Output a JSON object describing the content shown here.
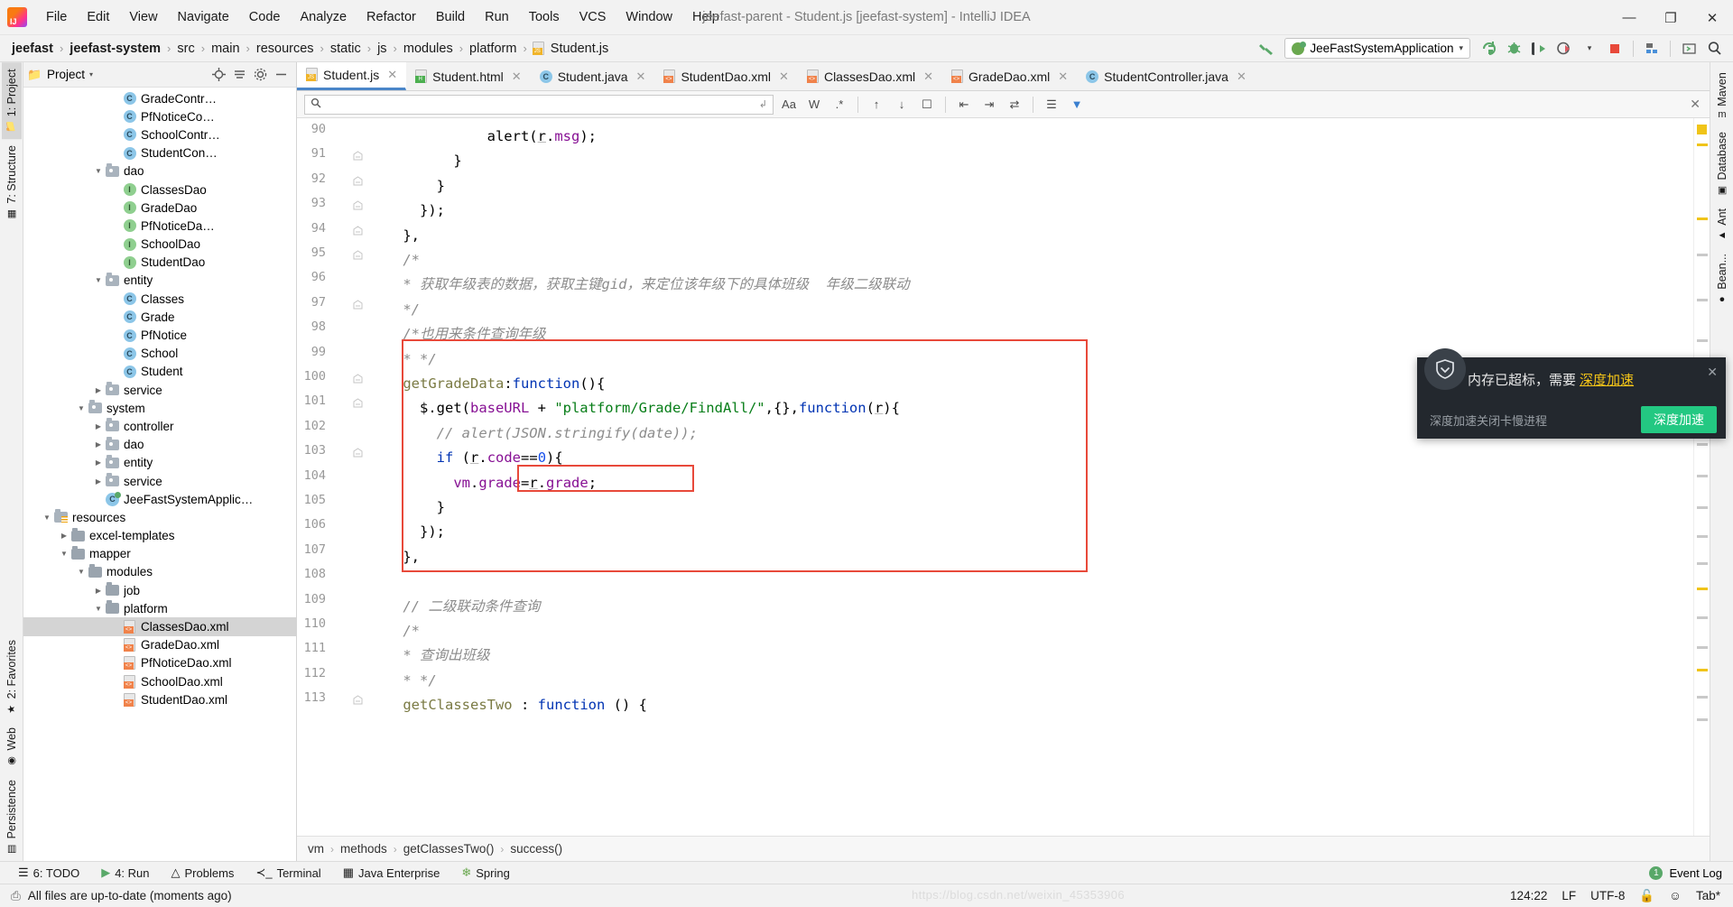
{
  "window": {
    "title": "jeefast-parent - Student.js [jeefast-system] - IntelliJ IDEA",
    "minimize": "—",
    "maximize": "❐",
    "close": "✕"
  },
  "menubar": {
    "items": [
      "File",
      "Edit",
      "View",
      "Navigate",
      "Code",
      "Analyze",
      "Refactor",
      "Build",
      "Run",
      "Tools",
      "VCS",
      "Window",
      "Help"
    ]
  },
  "breadcrumb": {
    "items": [
      "jeefast",
      "jeefast-system",
      "src",
      "main",
      "resources",
      "static",
      "js",
      "modules",
      "platform",
      "Student.js"
    ],
    "separator": "›"
  },
  "toolbar": {
    "run_config": "JeeFastSystemApplication",
    "dropdown_caret": "▾",
    "icons": [
      "rerun-icon",
      "debug-icon",
      "run-with-coverage-icon",
      "profiler-icon",
      "stop-icon",
      "project-structure-icon",
      "terminal-icon",
      "search-everywhere-icon"
    ],
    "hammer_icon": "build-icon"
  },
  "tool_windows_left": [
    {
      "label": "1: Project",
      "icon": "project-icon",
      "active": true
    },
    {
      "label": "7: Structure",
      "icon": "structure-icon",
      "active": false
    },
    {
      "label": "2: Favorites",
      "icon": "star-icon",
      "active": false
    },
    {
      "label": "Web",
      "icon": "web-icon",
      "active": false
    },
    {
      "label": "Persistence",
      "icon": "persistence-icon",
      "active": false
    }
  ],
  "tool_windows_right": [
    {
      "label": "Maven",
      "icon": "maven-icon"
    },
    {
      "label": "Database",
      "icon": "database-icon"
    },
    {
      "label": "Ant",
      "icon": "ant-icon"
    },
    {
      "label": "Bean...",
      "icon": "bean-icon"
    }
  ],
  "project_panel": {
    "title": "Project",
    "caret": "▾",
    "header_icons": [
      "locate-icon",
      "collapse-all-icon",
      "settings-icon",
      "hide-icon"
    ],
    "tree": [
      {
        "indent": 5,
        "arrow": "",
        "icon": "class-icon",
        "label": "GradeContr…",
        "selected": false
      },
      {
        "indent": 5,
        "arrow": "",
        "icon": "class-icon",
        "label": "PfNoticeCo…",
        "selected": false
      },
      {
        "indent": 5,
        "arrow": "",
        "icon": "class-icon",
        "label": "SchoolContr…",
        "selected": false
      },
      {
        "indent": 5,
        "arrow": "",
        "icon": "class-icon",
        "label": "StudentCon…",
        "selected": false
      },
      {
        "indent": 4,
        "arrow": "▼",
        "icon": "folder-icon",
        "label": "dao",
        "selected": false
      },
      {
        "indent": 5,
        "arrow": "",
        "icon": "interface-icon",
        "label": "ClassesDao",
        "selected": false
      },
      {
        "indent": 5,
        "arrow": "",
        "icon": "interface-icon",
        "label": "GradeDao",
        "selected": false
      },
      {
        "indent": 5,
        "arrow": "",
        "icon": "interface-icon",
        "label": "PfNoticeDa…",
        "selected": false
      },
      {
        "indent": 5,
        "arrow": "",
        "icon": "interface-icon",
        "label": "SchoolDao",
        "selected": false
      },
      {
        "indent": 5,
        "arrow": "",
        "icon": "interface-icon",
        "label": "StudentDao",
        "selected": false
      },
      {
        "indent": 4,
        "arrow": "▼",
        "icon": "folder-icon",
        "label": "entity",
        "selected": false
      },
      {
        "indent": 5,
        "arrow": "",
        "icon": "class-icon",
        "label": "Classes",
        "selected": false
      },
      {
        "indent": 5,
        "arrow": "",
        "icon": "class-icon",
        "label": "Grade",
        "selected": false
      },
      {
        "indent": 5,
        "arrow": "",
        "icon": "class-icon",
        "label": "PfNotice",
        "selected": false
      },
      {
        "indent": 5,
        "arrow": "",
        "icon": "class-icon",
        "label": "School",
        "selected": false
      },
      {
        "indent": 5,
        "arrow": "",
        "icon": "class-icon",
        "label": "Student",
        "selected": false
      },
      {
        "indent": 4,
        "arrow": "▶",
        "icon": "folder-icon",
        "label": "service",
        "selected": false
      },
      {
        "indent": 3,
        "arrow": "▼",
        "icon": "folder-icon",
        "label": "system",
        "selected": false
      },
      {
        "indent": 4,
        "arrow": "▶",
        "icon": "folder-icon",
        "label": "controller",
        "selected": false
      },
      {
        "indent": 4,
        "arrow": "▶",
        "icon": "folder-icon",
        "label": "dao",
        "selected": false
      },
      {
        "indent": 4,
        "arrow": "▶",
        "icon": "folder-icon",
        "label": "entity",
        "selected": false
      },
      {
        "indent": 4,
        "arrow": "▶",
        "icon": "folder-icon",
        "label": "service",
        "selected": false
      },
      {
        "indent": 4,
        "arrow": "",
        "icon": "spring-class-icon",
        "label": "JeeFastSystemApplic…",
        "selected": false
      },
      {
        "indent": 1,
        "arrow": "▼",
        "icon": "resources-folder-icon",
        "label": "resources",
        "selected": false
      },
      {
        "indent": 2,
        "arrow": "▶",
        "icon": "folder-plain-icon",
        "label": "excel-templates",
        "selected": false
      },
      {
        "indent": 2,
        "arrow": "▼",
        "icon": "folder-plain-icon",
        "label": "mapper",
        "selected": false
      },
      {
        "indent": 3,
        "arrow": "▼",
        "icon": "folder-plain-icon",
        "label": "modules",
        "selected": false
      },
      {
        "indent": 4,
        "arrow": "▶",
        "icon": "folder-plain-icon",
        "label": "job",
        "selected": false
      },
      {
        "indent": 4,
        "arrow": "▼",
        "icon": "folder-plain-icon",
        "label": "platform",
        "selected": false
      },
      {
        "indent": 5,
        "arrow": "",
        "icon": "xml-icon",
        "label": "ClassesDao.xml",
        "selected": true
      },
      {
        "indent": 5,
        "arrow": "",
        "icon": "xml-icon",
        "label": "GradeDao.xml",
        "selected": false
      },
      {
        "indent": 5,
        "arrow": "",
        "icon": "xml-icon",
        "label": "PfNoticeDao.xml",
        "selected": false
      },
      {
        "indent": 5,
        "arrow": "",
        "icon": "xml-icon",
        "label": "SchoolDao.xml",
        "selected": false
      },
      {
        "indent": 5,
        "arrow": "",
        "icon": "xml-icon",
        "label": "StudentDao.xml",
        "selected": false
      }
    ]
  },
  "editor_tabs": [
    {
      "label": "Student.js",
      "icon": "js-file-icon",
      "active": true
    },
    {
      "label": "Student.html",
      "icon": "html-file-icon",
      "active": false
    },
    {
      "label": "Student.java",
      "icon": "java-class-icon",
      "active": false
    },
    {
      "label": "StudentDao.xml",
      "icon": "xml-file-icon",
      "active": false
    },
    {
      "label": "ClassesDao.xml",
      "icon": "xml-file-icon",
      "active": false
    },
    {
      "label": "GradeDao.xml",
      "icon": "xml-file-icon",
      "active": false
    },
    {
      "label": "StudentController.java",
      "icon": "java-class-icon",
      "active": false
    }
  ],
  "find_bar": {
    "placeholder": "",
    "value": "",
    "match_case": "Aa",
    "words": "W",
    "regex": ".*",
    "icons": [
      "prev-occurrence-icon",
      "next-occurrence-icon",
      "select-all-icon",
      "expand-icon",
      "collapse-icon",
      "expand-all-icon",
      "filter-settings-icon",
      "filter-icon"
    ],
    "close": "✕"
  },
  "code": {
    "first_line_number": 90,
    "lines": [
      {
        "n": 90,
        "fold": false,
        "indent": 14,
        "tokens": [
          {
            "t": "alert(",
            "c": "cmt"
          },
          {
            "t": "r",
            "c": "cmt"
          },
          {
            "t": ".msg);",
            "c": "cmt"
          }
        ],
        "raw": "              alert(r.msg);"
      },
      {
        "n": 91,
        "fold": true,
        "indent": 10,
        "raw": "          }"
      },
      {
        "n": 92,
        "fold": true,
        "indent": 8,
        "raw": "        }"
      },
      {
        "n": 93,
        "fold": true,
        "indent": 6,
        "raw": "      });"
      },
      {
        "n": 94,
        "fold": true,
        "indent": 4,
        "raw": "    },"
      },
      {
        "n": 95,
        "fold": true,
        "indent": 4,
        "raw": "    /*"
      },
      {
        "n": 96,
        "fold": false,
        "indent": 4,
        "raw": "    * 获取年级表的数据，获取主键gid，来定位该年级下的具体班级  年级二级联动"
      },
      {
        "n": 97,
        "fold": true,
        "indent": 4,
        "raw": "    */"
      },
      {
        "n": 98,
        "fold": false,
        "indent": 4,
        "raw": "    /*也用来条件查询年级"
      },
      {
        "n": 99,
        "fold": false,
        "indent": 4,
        "raw": "    * */"
      },
      {
        "n": 100,
        "fold": true,
        "indent": 4,
        "raw": "    getGradeData:function(){"
      },
      {
        "n": 101,
        "fold": true,
        "indent": 6,
        "raw": "      $.get(baseURL + \"platform/Grade/FindAll/\",{},function(r){"
      },
      {
        "n": 102,
        "fold": false,
        "indent": 8,
        "raw": "        // alert(JSON.stringify(date));"
      },
      {
        "n": 103,
        "fold": true,
        "indent": 8,
        "raw": "        if (r.code==0){"
      },
      {
        "n": 104,
        "fold": false,
        "indent": 10,
        "raw": "          vm.grade=r.grade;"
      },
      {
        "n": 105,
        "fold": false,
        "indent": 8,
        "raw": "        }"
      },
      {
        "n": 106,
        "fold": false,
        "indent": 6,
        "raw": "      });"
      },
      {
        "n": 107,
        "fold": false,
        "indent": 4,
        "raw": "    },"
      },
      {
        "n": 108,
        "fold": false,
        "indent": 4,
        "raw": ""
      },
      {
        "n": 109,
        "fold": false,
        "indent": 4,
        "raw": "    // 二级联动条件查询"
      },
      {
        "n": 110,
        "fold": false,
        "indent": 4,
        "raw": "    /*"
      },
      {
        "n": 111,
        "fold": false,
        "indent": 4,
        "raw": "    * 查询出班级"
      },
      {
        "n": 112,
        "fold": false,
        "indent": 4,
        "raw": "    * */"
      },
      {
        "n": 113,
        "fold": true,
        "indent": 4,
        "raw": "    getClassesTwo : function () {"
      }
    ],
    "highlight_box_outer": "getGradeData function block",
    "highlight_box_inner": "vm.grade=r.grade;"
  },
  "structure_breadcrumb": {
    "items": [
      "vm",
      "methods",
      "getClassesTwo()",
      "success()"
    ],
    "separator": "›"
  },
  "bottom_tools": [
    {
      "label": "6: TODO",
      "icon": "todo-icon"
    },
    {
      "label": "4: Run",
      "icon": "run-icon"
    },
    {
      "label": "Problems",
      "icon": "problems-icon"
    },
    {
      "label": "Terminal",
      "icon": "terminal-icon"
    },
    {
      "label": "Java Enterprise",
      "icon": "java-enterprise-icon"
    },
    {
      "label": "Spring",
      "icon": "spring-leaf-icon"
    }
  ],
  "event_log": {
    "label": "Event Log",
    "count": "1"
  },
  "status_bar": {
    "message": "All files are up-to-date (moments ago)",
    "caret_position": "124:22",
    "line_separator": "LF",
    "encoding": "UTF-8",
    "lock_icon": "unlocked-icon",
    "inspection_icon": "hector-icon",
    "indent": "Tab*",
    "watermark": "https://blog.csdn.net/weixin_45353906"
  },
  "notification": {
    "title_prefix": "内存已超标，需要",
    "title_accent": "深度加速",
    "subtitle": "深度加速关闭卡慢进程",
    "button": "深度加速",
    "close": "✕",
    "shield_icon": "shield-icon",
    "accent_color": "#f5c518",
    "button_color": "#23c882",
    "background": "#23282e"
  }
}
